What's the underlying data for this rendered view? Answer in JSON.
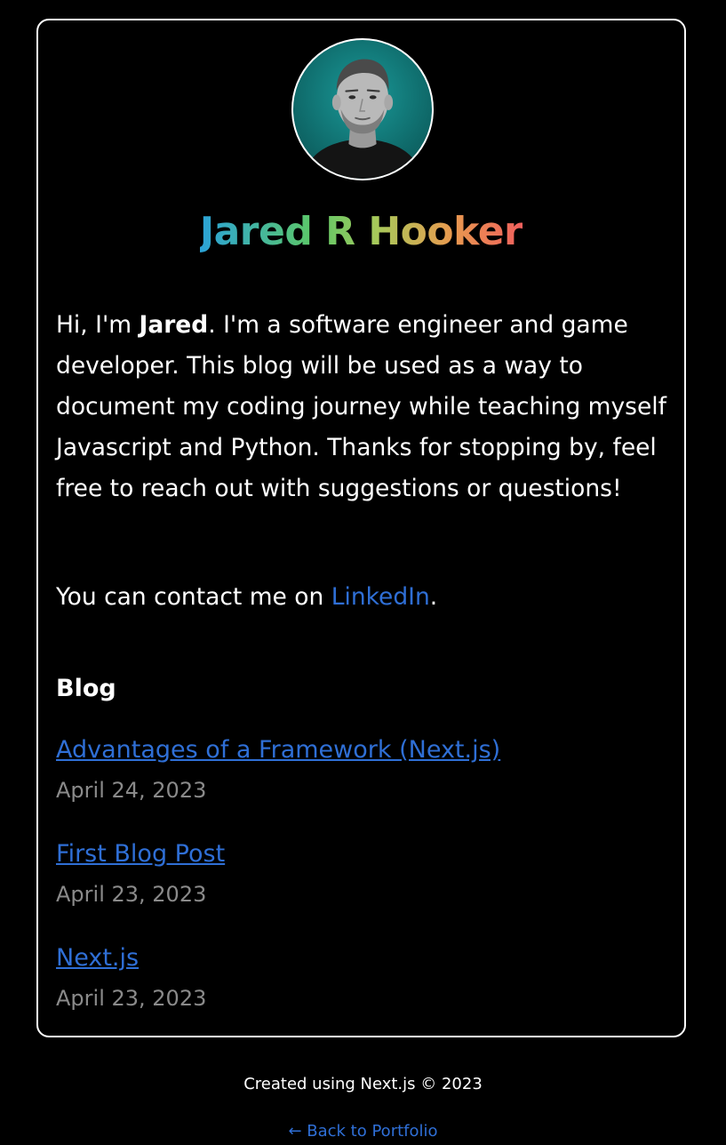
{
  "profile": {
    "name": "Jared R Hooker",
    "avatar_alt": "profile photo"
  },
  "bio": {
    "intro_prefix": "Hi, I'm ",
    "intro_name": "Jared",
    "intro_rest": ". I'm a software engineer and game developer. This blog will be used as a way to document my coding journey while teaching myself Javascript and Python. Thanks for stopping by, feel free to reach out with suggestions or questions!",
    "contact_prefix": "You can contact me on ",
    "contact_link": "LinkedIn",
    "contact_suffix": "."
  },
  "blog": {
    "heading": "Blog",
    "posts": [
      {
        "title": "Advantages of a Framework (Next.js)",
        "date": "April 24, 2023"
      },
      {
        "title": "First Blog Post",
        "date": "April 23, 2023"
      },
      {
        "title": "Next.js",
        "date": "April 23, 2023"
      }
    ]
  },
  "footer": {
    "text": "Created using Next.js © 2023",
    "back_link": "← Back to Portfolio"
  },
  "colors": {
    "background": "#000000",
    "link": "#2f6fd6",
    "date": "#8a8a8a",
    "gradient": [
      "#2ba3d8",
      "#5cc768",
      "#a8c95a",
      "#e89a4f",
      "#f0605d"
    ]
  }
}
